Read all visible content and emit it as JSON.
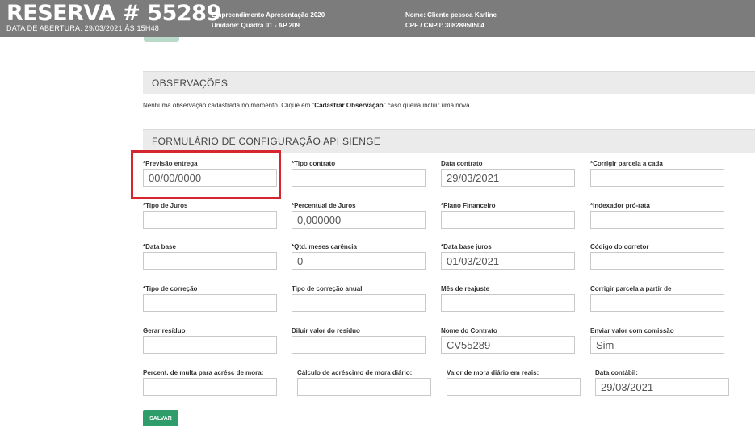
{
  "header": {
    "title": "RESERVA # 55289",
    "subtitle": "DATA DE ABERTURA: 29/03/2021 ÀS 15H48",
    "empreendimento_label": "Empreendimento Apresentação 2020",
    "unidade_label": "Unidade:",
    "unidade_value": "Quadra 01 - AP 209",
    "nome_label": "Nome:",
    "nome_value": "Cliente pessoa Karline",
    "cpf_label": "CPF / CNPJ:",
    "cpf_value": "30828950504"
  },
  "observacoes": {
    "title": "OBSERVAÇÕES",
    "text_before": "Nenhuma observação cadastrada no momento. Clique em \"",
    "link_text": "Cadastrar Observação",
    "text_after": "\" caso queira incluir uma nova."
  },
  "form": {
    "title": "FORMULÁRIO DE CONFIGURAÇÃO API SIENGE",
    "fields": [
      {
        "label": "*Previsão entrega",
        "value": "00/00/0000"
      },
      {
        "label": "*Tipo contrato",
        "value": ""
      },
      {
        "label": "Data contrato",
        "value": "29/03/2021"
      },
      {
        "label": "*Corrigir parcela a cada",
        "value": ""
      },
      {
        "label": "*Tipo de Juros",
        "value": ""
      },
      {
        "label": "*Percentual de Juros",
        "value": "0,000000"
      },
      {
        "label": "*Plano Financeiro",
        "value": ""
      },
      {
        "label": "*Indexador pró-rata",
        "value": ""
      },
      {
        "label": "*Data base",
        "value": ""
      },
      {
        "label": "*Qtd. meses carência",
        "value": "0"
      },
      {
        "label": "*Data base juros",
        "value": "01/03/2021"
      },
      {
        "label": "Código do corretor",
        "value": ""
      },
      {
        "label": "*Tipo de correção",
        "value": ""
      },
      {
        "label": "Tipo de correção anual",
        "value": ""
      },
      {
        "label": "Mês de reajuste",
        "value": ""
      },
      {
        "label": "Corrigir parcela a partir de",
        "value": ""
      },
      {
        "label": "Gerar resíduo",
        "value": ""
      },
      {
        "label": "Diluir valor do resíduo",
        "value": ""
      },
      {
        "label": "Nome do Contrato",
        "value": "CV55289"
      },
      {
        "label": "Enviar valor com comissão",
        "value": "Sim"
      },
      {
        "label": "Percent. de multa para acrésc de mora:",
        "value": ""
      },
      {
        "label": "Cálculo de acréscimo de mora diário:",
        "value": ""
      },
      {
        "label": "Valor de mora diário em reais:",
        "value": ""
      },
      {
        "label": "Data contábil:",
        "value": "29/03/2021"
      }
    ],
    "save_label": "SALVAR"
  },
  "colors": {
    "header_bg": "#7c7c7c",
    "save_button": "#2e9d6a",
    "highlight": "#d7252f"
  }
}
